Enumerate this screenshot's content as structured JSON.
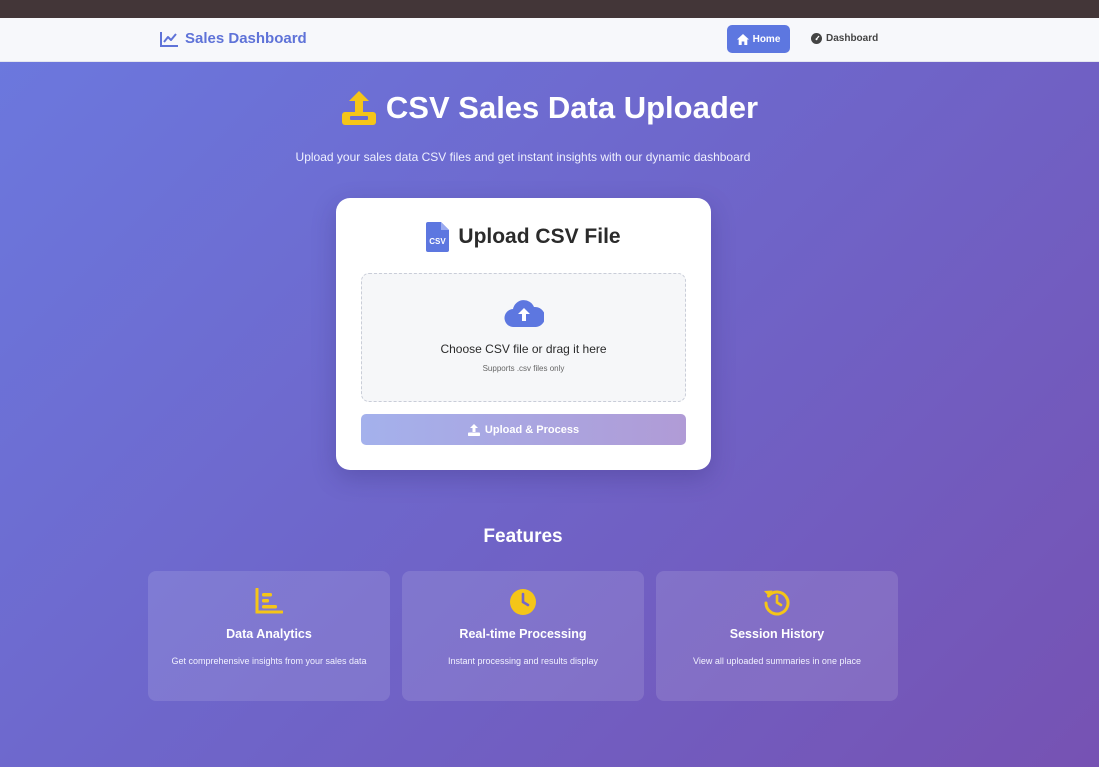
{
  "navbar": {
    "brand": "Sales Dashboard",
    "home_label": "Home",
    "dashboard_label": "Dashboard"
  },
  "hero": {
    "title": "CSV Sales Data Uploader",
    "subtitle": "Upload your sales data CSV files and get instant insights with our dynamic dashboard"
  },
  "upload_card": {
    "title": "Upload CSV File",
    "file_icon_text": "CSV",
    "dropzone_text": "Choose CSV file or drag it here",
    "dropzone_hint": "Supports .csv files only",
    "button_label": "Upload & Process"
  },
  "features": {
    "title": "Features",
    "items": [
      {
        "icon": "bar-chart-icon",
        "title": "Data Analytics",
        "desc": "Get comprehensive insights from your sales data"
      },
      {
        "icon": "clock-icon",
        "title": "Real-time Processing",
        "desc": "Instant processing and results display"
      },
      {
        "icon": "history-icon",
        "title": "Session History",
        "desc": "View all uploaded summaries in one place"
      }
    ]
  },
  "colors": {
    "accent": "#5d77e0",
    "feature_icon": "#f5c518",
    "topstrip": "#433638"
  }
}
